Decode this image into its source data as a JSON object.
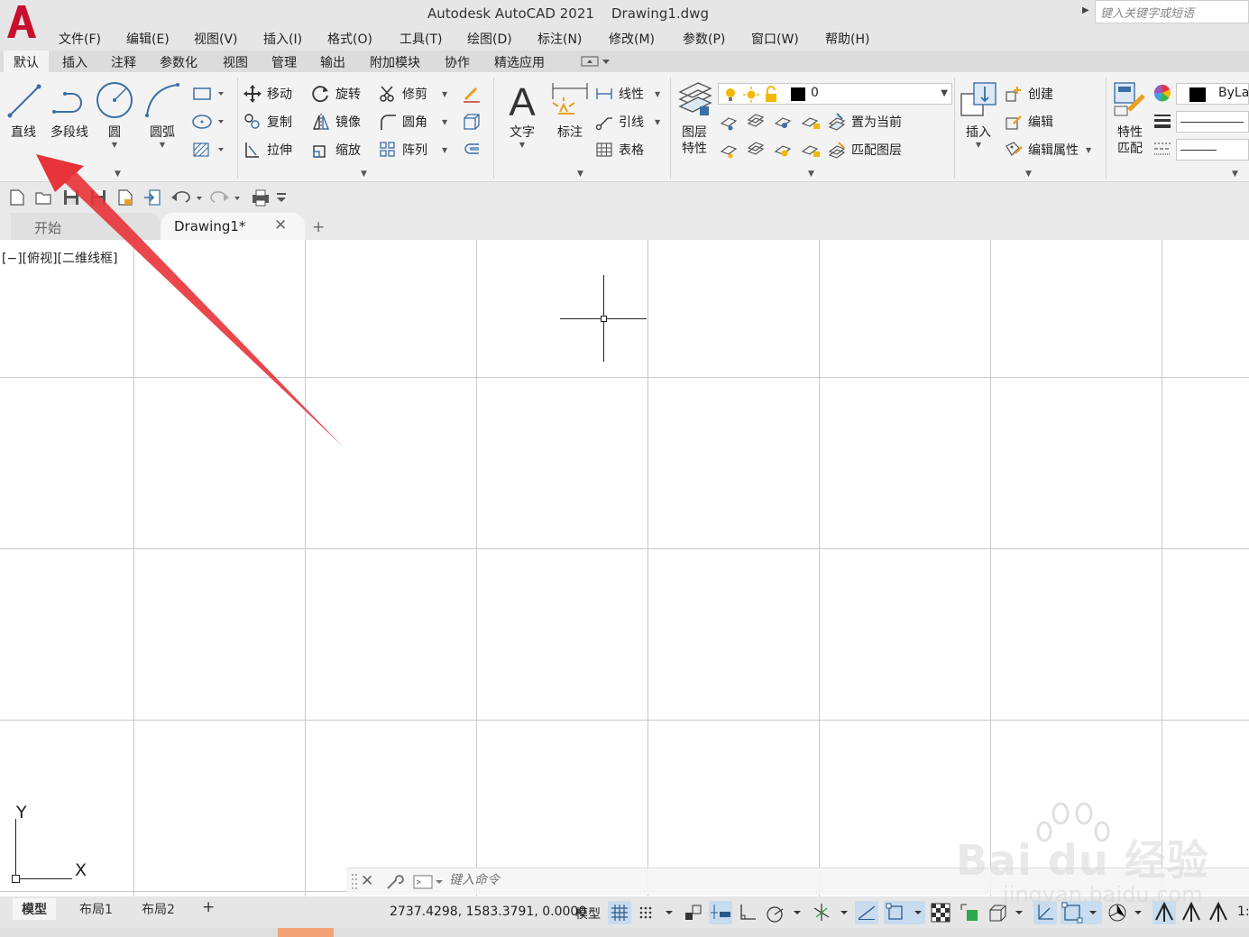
{
  "app": {
    "title": "Autodesk AutoCAD 2021    Drawing1.dwg",
    "logo_icon": "autocad-logo-icon"
  },
  "search": {
    "placeholder": "键入关键字或短语"
  },
  "menu": [
    "文件(F)",
    "编辑(E)",
    "视图(V)",
    "插入(I)",
    "格式(O)",
    "工具(T)",
    "绘图(D)",
    "标注(N)",
    "修改(M)",
    "参数(P)",
    "窗口(W)",
    "帮助(H)"
  ],
  "ribbon_tabs": [
    "默认",
    "插入",
    "注释",
    "参数化",
    "视图",
    "管理",
    "输出",
    "附加模块",
    "协作",
    "精选应用"
  ],
  "ribbon_active_tab": "默认",
  "draw_panel": {
    "line": "直线",
    "polyline": "多段线",
    "circle": "圆",
    "arc": "圆弧"
  },
  "modify_panel": {
    "move": "移动",
    "rotate": "旋转",
    "trim": "修剪",
    "copy": "复制",
    "mirror": "镜像",
    "fillet": "圆角",
    "stretch": "拉伸",
    "scale": "缩放",
    "array": "阵列"
  },
  "annotation_panel": {
    "text": "文字",
    "dimension": "标注",
    "linear": "线性",
    "leader": "引线",
    "table": "表格"
  },
  "layers_panel": {
    "layer_properties_1": "图层",
    "layer_properties_2": "特性",
    "current_layer": "0",
    "set_current": "置为当前",
    "match_layer": "匹配图层"
  },
  "block_panel": {
    "insert": "插入",
    "create": "创建",
    "edit": "编辑",
    "edit_attributes": "编辑属性"
  },
  "properties_panel": {
    "match_1": "特性",
    "match_2": "匹配",
    "color_value": "ByLay"
  },
  "doc_tabs": {
    "start": "开始",
    "drawing": "Drawing1*",
    "add": "+"
  },
  "viewport": {
    "label": "[−][俯视][二维线框]"
  },
  "ucs": {
    "y": "Y",
    "x": "X"
  },
  "command": {
    "placeholder": "键入命令"
  },
  "status": {
    "layout_tabs": [
      "模型",
      "布局1",
      "布局2"
    ],
    "add_layout": "+",
    "coords": "2737.4298, 1583.3791, 0.0000",
    "model": "模型",
    "scale": "1:"
  },
  "watermark": {
    "brand": "Bai du 经验",
    "url": "jingyan.baidu.com"
  },
  "colors": {
    "accent_red": "#e8333a",
    "active_toggle": "#c7dcef",
    "ribbon_bg": "#f3f3f3",
    "layer_color": "#000000"
  }
}
